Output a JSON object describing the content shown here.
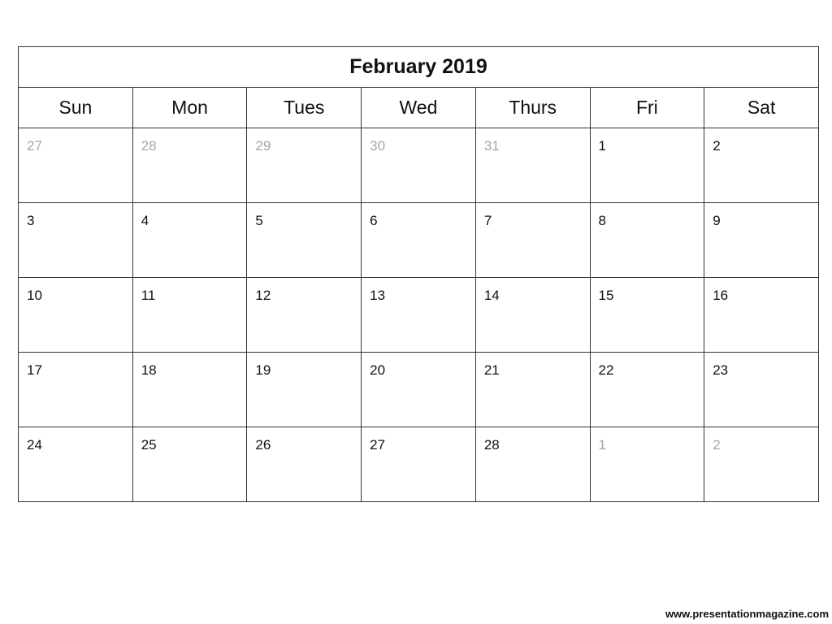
{
  "calendar": {
    "title": "February 2019",
    "weekdays": [
      "Sun",
      "Mon",
      "Tues",
      "Wed",
      "Thurs",
      "Fri",
      "Sat"
    ],
    "weeks": [
      [
        {
          "d": "27",
          "other": true
        },
        {
          "d": "28",
          "other": true
        },
        {
          "d": "29",
          "other": true
        },
        {
          "d": "30",
          "other": true
        },
        {
          "d": "31",
          "other": true
        },
        {
          "d": "1",
          "other": false
        },
        {
          "d": "2",
          "other": false
        }
      ],
      [
        {
          "d": "3",
          "other": false
        },
        {
          "d": "4",
          "other": false
        },
        {
          "d": "5",
          "other": false
        },
        {
          "d": "6",
          "other": false
        },
        {
          "d": "7",
          "other": false
        },
        {
          "d": "8",
          "other": false
        },
        {
          "d": "9",
          "other": false
        }
      ],
      [
        {
          "d": "10",
          "other": false
        },
        {
          "d": "11",
          "other": false
        },
        {
          "d": "12",
          "other": false
        },
        {
          "d": "13",
          "other": false
        },
        {
          "d": "14",
          "other": false
        },
        {
          "d": "15",
          "other": false
        },
        {
          "d": "16",
          "other": false
        }
      ],
      [
        {
          "d": "17",
          "other": false
        },
        {
          "d": "18",
          "other": false
        },
        {
          "d": "19",
          "other": false
        },
        {
          "d": "20",
          "other": false
        },
        {
          "d": "21",
          "other": false
        },
        {
          "d": "22",
          "other": false
        },
        {
          "d": "23",
          "other": false
        }
      ],
      [
        {
          "d": "24",
          "other": false
        },
        {
          "d": "25",
          "other": false
        },
        {
          "d": "26",
          "other": false
        },
        {
          "d": "27",
          "other": false
        },
        {
          "d": "28",
          "other": false
        },
        {
          "d": "1",
          "other": true
        },
        {
          "d": "2",
          "other": true
        }
      ]
    ]
  },
  "footer": {
    "text": "www.presentationmagazine.com"
  },
  "colors": {
    "current_month_text": "#111111",
    "other_month_text": "#a6a6a6",
    "grid": "#333333"
  }
}
